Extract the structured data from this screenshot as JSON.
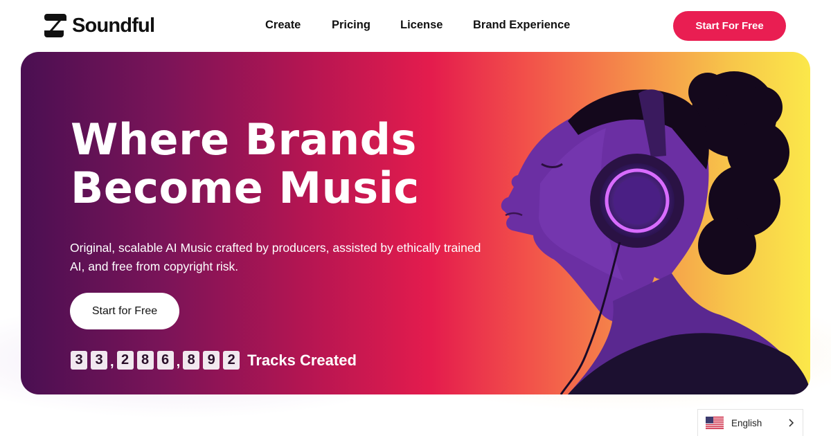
{
  "header": {
    "brand_name": "Soundful",
    "nav": [
      "Create",
      "Pricing",
      "License",
      "Brand Experience"
    ],
    "cta_label": "Start For Free"
  },
  "hero": {
    "title_line1": "Where Brands",
    "title_line2": "Become Music",
    "subtitle": "Original, scalable AI Music crafted by producers, assisted by ethically trained AI, and free from copyright risk.",
    "cta_label": "Start for Free",
    "counter_digits": [
      "3",
      "3",
      ",",
      "2",
      "8",
      "6",
      ",",
      "8",
      "9",
      "2"
    ],
    "counter_label": "Tracks Created"
  },
  "language_selector": {
    "label": "English",
    "flag_icon": "us-flag-icon"
  },
  "colors": {
    "accent": "#e91e52",
    "gradient_start": "#4a0f52",
    "gradient_end": "#fbe84a"
  }
}
